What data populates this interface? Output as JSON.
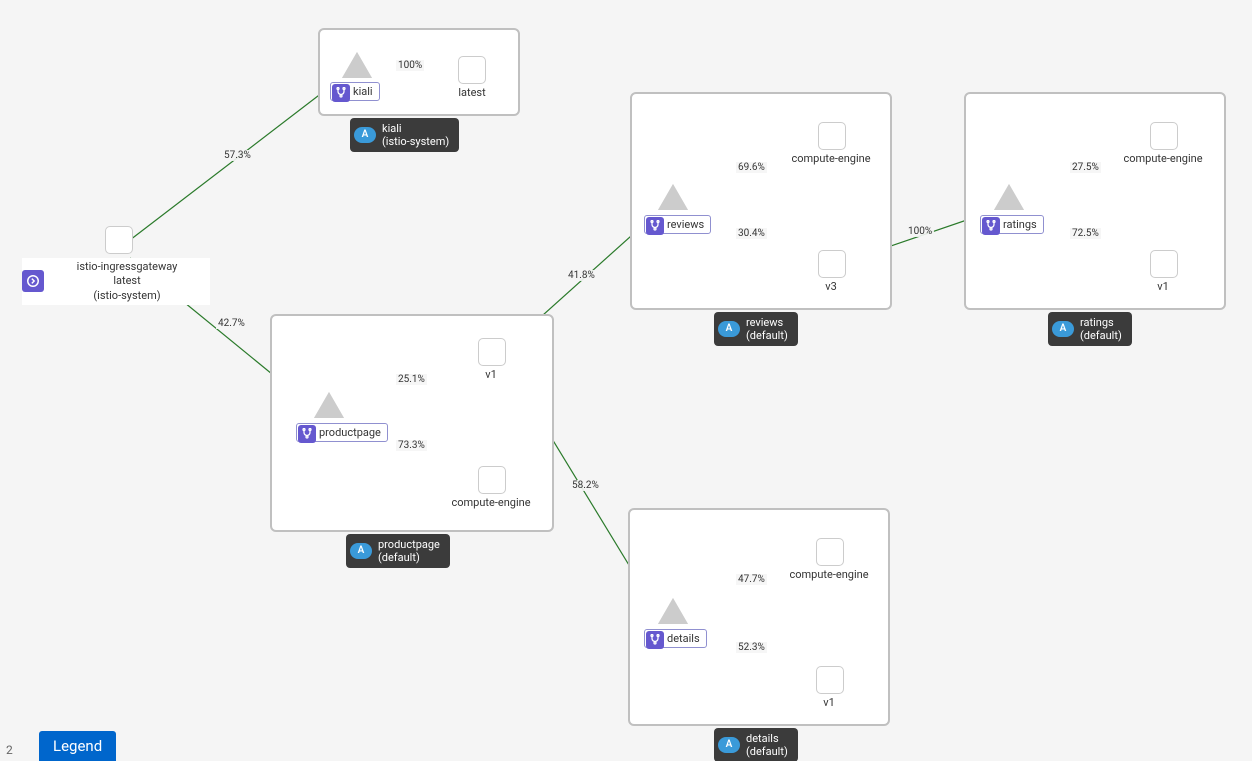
{
  "root": {
    "line1": "istio-ingressgateway",
    "line2": "latest",
    "line3": "(istio-system)"
  },
  "services": {
    "kiali": {
      "label": "kiali",
      "badge_title": "kiali",
      "badge_ns": "(istio-system)",
      "versions": [
        {
          "name": "latest"
        }
      ]
    },
    "productpage": {
      "label": "productpage",
      "badge_title": "productpage",
      "badge_ns": "(default)",
      "versions": [
        {
          "name": "v1"
        },
        {
          "name": "compute-engine"
        }
      ]
    },
    "reviews": {
      "label": "reviews",
      "badge_title": "reviews",
      "badge_ns": "(default)",
      "versions": [
        {
          "name": "compute-engine"
        },
        {
          "name": "v3"
        }
      ]
    },
    "details": {
      "label": "details",
      "badge_title": "details",
      "badge_ns": "(default)",
      "versions": [
        {
          "name": "compute-engine"
        },
        {
          "name": "v1"
        }
      ]
    },
    "ratings": {
      "label": "ratings",
      "badge_title": "ratings",
      "badge_ns": "(default)",
      "versions": [
        {
          "name": "compute-engine"
        },
        {
          "name": "v1"
        }
      ]
    }
  },
  "edges": {
    "root_kiali": "57.3%",
    "root_productpage": "42.7%",
    "kiali_latest": "100%",
    "pp_v1": "25.1%",
    "pp_ce": "73.3%",
    "v1_reviews": "41.8%",
    "v1_details": "58.2%",
    "reviews_ce": "69.6%",
    "reviews_v3": "30.4%",
    "v3_ratings": "100%",
    "ratings_ce": "27.5%",
    "ratings_v1": "72.5%",
    "details_ce": "47.7%",
    "details_v1": "52.3%"
  },
  "badge_a": "A",
  "legend": "Legend",
  "small": "2"
}
